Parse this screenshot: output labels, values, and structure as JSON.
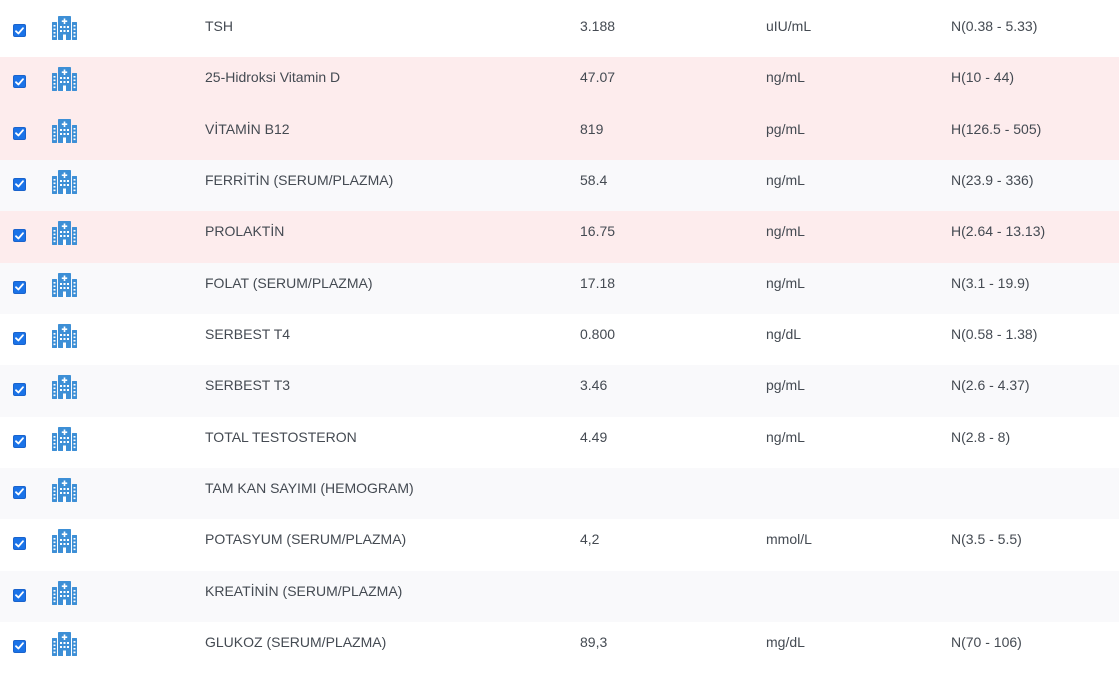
{
  "accent_color": "#1a73e8",
  "icon_color": "#3d8fd6",
  "high_row_color": "#fdeced",
  "rows": [
    {
      "checked": true,
      "icon": "hospital-icon",
      "name": "TSH",
      "value": "3.188",
      "unit": "uIU/mL",
      "ref": "N(0.38 - 5.33)",
      "flag": "N"
    },
    {
      "checked": true,
      "icon": "hospital-icon",
      "name": "25-Hidroksi Vitamin D",
      "value": "47.07",
      "unit": "ng/mL",
      "ref": "H(10 - 44)",
      "flag": "H"
    },
    {
      "checked": true,
      "icon": "hospital-icon",
      "name": "VİTAMİN B12",
      "value": "819",
      "unit": "pg/mL",
      "ref": "H(126.5 - 505)",
      "flag": "H"
    },
    {
      "checked": true,
      "icon": "hospital-icon",
      "name": "FERRİTİN (SERUM/PLAZMA)",
      "value": "58.4",
      "unit": "ng/mL",
      "ref": "N(23.9 - 336)",
      "flag": "N"
    },
    {
      "checked": true,
      "icon": "hospital-icon",
      "name": "PROLAKTİN",
      "value": "16.75",
      "unit": "ng/mL",
      "ref": "H(2.64 - 13.13)",
      "flag": "H"
    },
    {
      "checked": true,
      "icon": "hospital-icon",
      "name": "FOLAT (SERUM/PLAZMA)",
      "value": "17.18",
      "unit": "ng/mL",
      "ref": "N(3.1 - 19.9)",
      "flag": "N"
    },
    {
      "checked": true,
      "icon": "hospital-icon",
      "name": "SERBEST T4",
      "value": "0.800",
      "unit": "ng/dL",
      "ref": "N(0.58 - 1.38)",
      "flag": "N"
    },
    {
      "checked": true,
      "icon": "hospital-icon",
      "name": "SERBEST T3",
      "value": "3.46",
      "unit": "pg/mL",
      "ref": "N(2.6 - 4.37)",
      "flag": "N"
    },
    {
      "checked": true,
      "icon": "hospital-icon",
      "name": "TOTAL TESTOSTERON",
      "value": "4.49",
      "unit": "ng/mL",
      "ref": "N(2.8 - 8)",
      "flag": "N"
    },
    {
      "checked": true,
      "icon": "hospital-icon",
      "name": "TAM KAN SAYIMI (HEMOGRAM)",
      "value": "",
      "unit": "",
      "ref": "",
      "flag": ""
    },
    {
      "checked": true,
      "icon": "hospital-icon",
      "name": "POTASYUM (SERUM/PLAZMA)",
      "value": "4,2",
      "unit": "mmol/L",
      "ref": "N(3.5 - 5.5)",
      "flag": "N"
    },
    {
      "checked": true,
      "icon": "hospital-icon",
      "name": "KREATİNİN (SERUM/PLAZMA)",
      "value": "",
      "unit": "",
      "ref": "",
      "flag": ""
    },
    {
      "checked": true,
      "icon": "hospital-icon",
      "name": "GLUKOZ (SERUM/PLAZMA)",
      "value": "89,3",
      "unit": "mg/dL",
      "ref": "N(70 - 106)",
      "flag": "N"
    }
  ]
}
